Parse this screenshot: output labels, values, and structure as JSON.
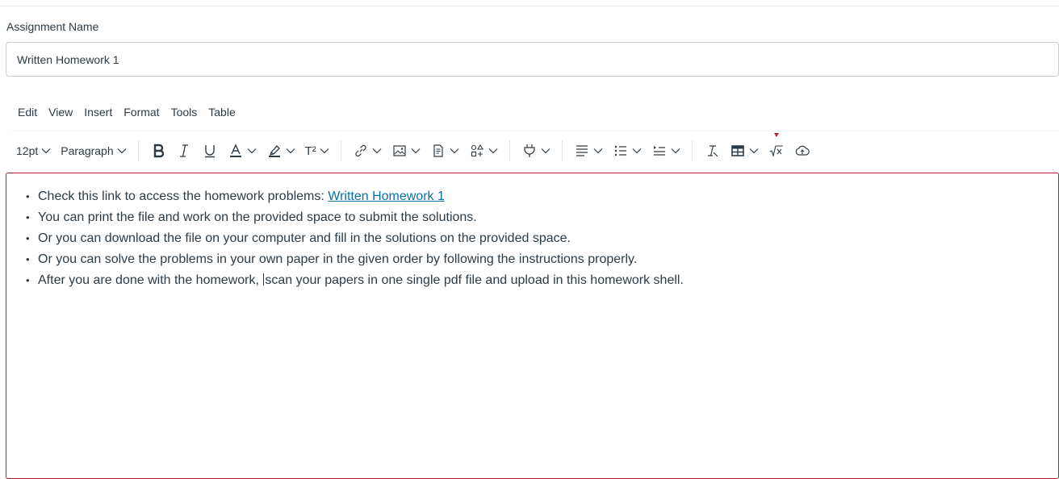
{
  "assignment": {
    "label": "Assignment Name",
    "value": "Written Homework 1"
  },
  "menubar": {
    "items": [
      "Edit",
      "View",
      "Insert",
      "Format",
      "Tools",
      "Table"
    ]
  },
  "toolbar": {
    "font_size": "12pt",
    "block_format": "Paragraph",
    "superscript_label": "T²"
  },
  "editor": {
    "border_color": "#b41c2d",
    "link_color": "#0770a3",
    "bullets": {
      "item1_prefix": "Check this link to access the homework problems: ",
      "item1_link": "Written Homework 1",
      "item2": "You can print the file and work on the provided space to submit the solutions.",
      "item3": "Or you can download the file on your computer and fill in the solutions on the provided space.",
      "item4": "Or you can solve the problems in your own paper in the given order by following the instructions properly.",
      "item5_before_cursor": "After you are done with the homework, ",
      "item5_after_cursor": "scan your papers in one single pdf file and upload in this homework shell."
    }
  }
}
